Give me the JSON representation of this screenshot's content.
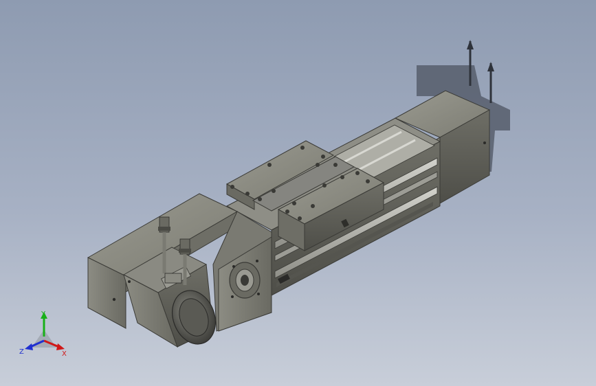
{
  "window": {
    "title": ""
  },
  "colors": {
    "background_top": "#8e9bb1",
    "background_bottom": "#c8ced9",
    "body_light": "#8a8a80",
    "body_mid": "#6f6f66",
    "body_dark": "#4a4a44",
    "rail": "#b9b9b2",
    "shadow": "#555a66",
    "axis_x": "#d01818",
    "axis_y": "#18b018",
    "axis_z": "#2030d0"
  },
  "model": {
    "name": "linear-module-with-servo-motor",
    "parts": [
      "motor-housing",
      "servo-motor",
      "motor-flange",
      "rail-body",
      "carriage-slide",
      "end-cap",
      "connector-cables"
    ]
  },
  "triad": {
    "x_label": "X",
    "y_label": "Y",
    "z_label": "Z"
  }
}
